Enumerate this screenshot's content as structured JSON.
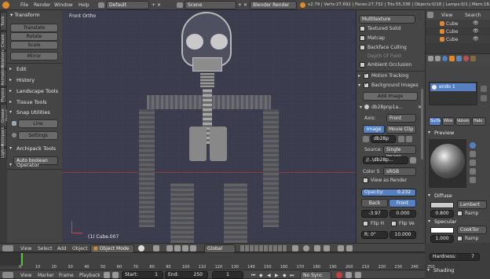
{
  "topbar": {
    "menus": [
      "File",
      "Render",
      "Window",
      "Help"
    ],
    "layout": "Default",
    "scene": "Scene",
    "engine": "Blender Render",
    "stats": "v2.79 | Verts:27,692 | Faces:27,732 | Tris:55,336 | Objects:0/18 | Lamps:0/1 | Mem:18.4"
  },
  "left_tabs": [
    "Tools",
    "Create",
    "Relations",
    "Animation",
    "Physics",
    "Grease Pencil",
    "Archipack",
    "Lightm"
  ],
  "toolshelf": {
    "transform_header": "Transform",
    "transform_buttons": [
      "Translate",
      "Rotate",
      "Scale"
    ],
    "mirror": "Mirror",
    "edit": "Edit",
    "history": "History",
    "landscape": "Landscape Tools",
    "tissue": "Tissue Tools",
    "snap": "Snap Utilities",
    "line": "Line",
    "settings": "Settings",
    "archipack": "Archipack Tools",
    "auto_boolean": "Auto boolean",
    "operator": "Operator"
  },
  "viewport": {
    "label": "Front Ortho",
    "object": "(1) Cube.007"
  },
  "n_panel": {
    "multitexture": "Multitexture",
    "textured_solid": "Textured Solid",
    "matcap": "Matcap",
    "backface": "Backface Culling",
    "dof": "Depth Of Field",
    "ao": "Ambient Occlusion",
    "motion_tracking": "Motion Tracking",
    "background_images": "Background Images",
    "add_image": "Add Image",
    "image_name": "db28pnp1a...",
    "axis_label": "Axis:",
    "axis_value": "Front",
    "image_tab": "Image",
    "movie_clip_tab": "Movie Clip",
    "image_field": "db28p",
    "source_label": "Source:",
    "source_value": "Single Image",
    "path": "//..\\db28p...",
    "color_space_label": "Color S",
    "color_space_value": "sRGB",
    "view_as_render": "View as Render",
    "opacity_label": "Opacity:",
    "opacity_value": "0.232",
    "back": "Back",
    "front": "Front",
    "offset_x": "-3.97",
    "offset_y": "0.000",
    "flip_h": "Flip H",
    "flip_v": "Flip Ve",
    "rot_label": "R:",
    "rot_value": "0°",
    "size_value": "10.000"
  },
  "outliner": {
    "header_view": "View",
    "header_search": "Search",
    "items": [
      "Cube",
      "Cube",
      "Cube"
    ]
  },
  "properties": {
    "material_name": "endo 1",
    "tabs": [
      "Surfa",
      "Wire",
      "Volum",
      "Halo"
    ],
    "preview": "Preview",
    "diffuse": "Diffuse",
    "diffuse_shader": "Lambert",
    "diffuse_intensity": "0.800",
    "ramp": "Ramp",
    "specular": "Specular",
    "spec_shader": "CookTor",
    "spec_intensity": "1.000",
    "hardness": "Hardness:",
    "hardness_value": "7",
    "shading": "Shading"
  },
  "view3d_header": {
    "view": "View",
    "select": "Select",
    "add": "Add",
    "object": "Object",
    "mode": "Object Mode",
    "orientation": "Global"
  },
  "timeline": {
    "ticks": [
      "0",
      "10",
      "20",
      "30",
      "40",
      "50",
      "60",
      "70",
      "80",
      "90",
      "100",
      "110",
      "120",
      "130",
      "140",
      "150",
      "160",
      "170",
      "180",
      "190",
      "200",
      "210",
      "220",
      "230",
      "240",
      "250"
    ],
    "view": "View",
    "marker": "Marker",
    "frame": "Frame",
    "playback": "Playback",
    "start_label": "Start:",
    "start_value": "1",
    "end_label": "End:",
    "end_value": "250",
    "current": "1",
    "sync": "No Sync"
  },
  "colors": {
    "viewport_bg": "#393b4b",
    "accent_blue": "#5680c2",
    "orange": "#e08a2c"
  }
}
